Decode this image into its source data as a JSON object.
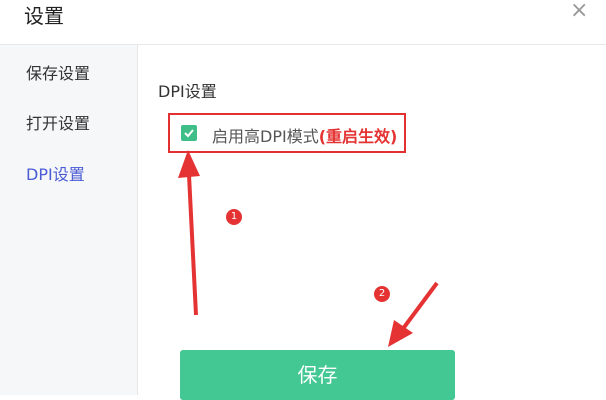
{
  "dialog": {
    "title": "设置",
    "close_icon": "close-icon"
  },
  "sidebar": {
    "items": [
      {
        "label": "保存设置"
      },
      {
        "label": "打开设置"
      },
      {
        "label": "DPI设置",
        "active": true
      }
    ]
  },
  "dpi": {
    "section_title": "DPI设置",
    "option_label": "启用高DPI模式",
    "option_note": "(重启生效)",
    "checked": true
  },
  "annotations": {
    "step1": "1",
    "step2": "2"
  },
  "save_button": {
    "label": "保存"
  },
  "colors": {
    "accent_green": "#43c793",
    "checkbox_green": "#3fbe8a",
    "active_nav": "#4a5bd4",
    "annotation_red": "#e53333"
  }
}
